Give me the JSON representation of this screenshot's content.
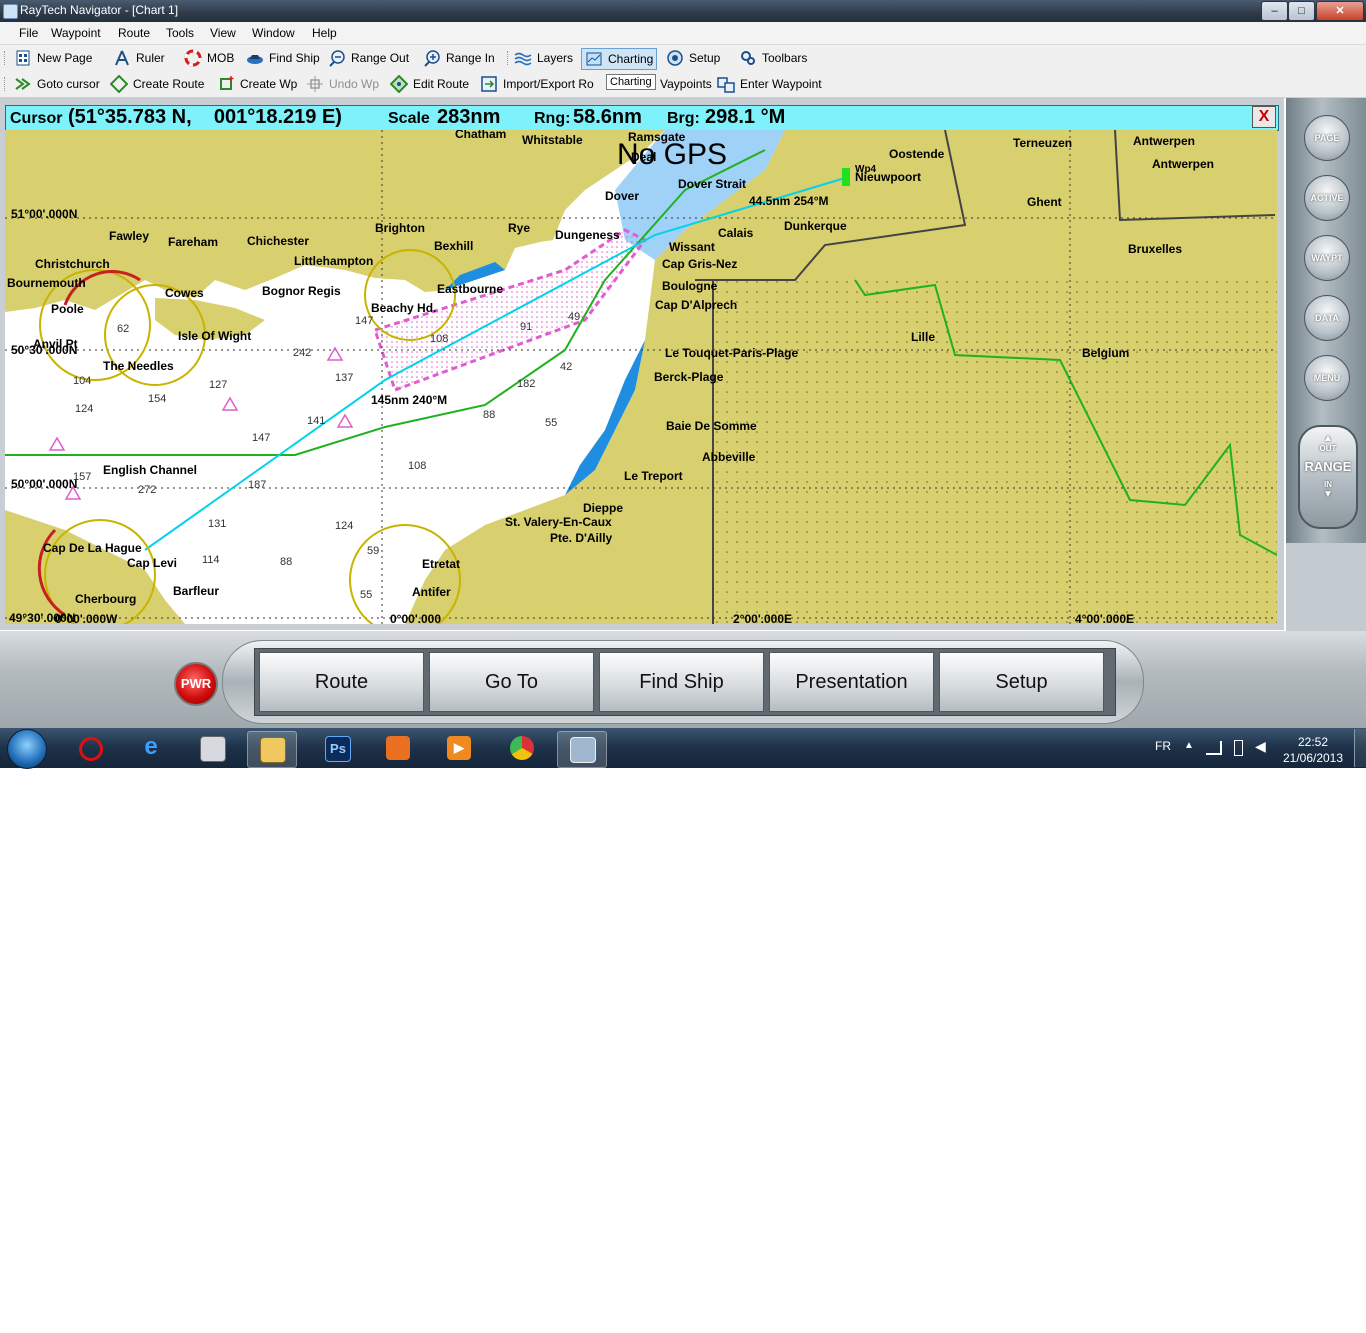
{
  "window": {
    "title": "RayTech Navigator - [Chart 1]",
    "minimize": "–",
    "maximize": "□",
    "close": "✕"
  },
  "menu": [
    "File",
    "Waypoint",
    "Route",
    "Tools",
    "View",
    "Window",
    "Help"
  ],
  "toolbar1": [
    {
      "label": "New Page",
      "icon": "new-page-icon"
    },
    {
      "label": "Ruler",
      "icon": "ruler-icon"
    },
    {
      "label": "MOB",
      "icon": "mob-icon"
    },
    {
      "label": "Find Ship",
      "icon": "find-ship-icon"
    },
    {
      "label": "Range Out",
      "icon": "zoom-out-icon"
    },
    {
      "label": "Range In",
      "icon": "zoom-in-icon"
    },
    {
      "label": "Layers",
      "icon": "layers-icon"
    },
    {
      "label": "Charting",
      "icon": "charting-icon"
    },
    {
      "label": "Setup",
      "icon": "setup-icon"
    },
    {
      "label": "Toolbars",
      "icon": "toolbars-icon"
    }
  ],
  "toolbar2": [
    {
      "label": "Goto cursor",
      "icon": "goto-cursor-icon"
    },
    {
      "label": "Create Route",
      "icon": "create-route-icon"
    },
    {
      "label": "Create Wp",
      "icon": "create-waypoint-icon"
    },
    {
      "label": "Undo Wp",
      "icon": "undo-waypoint-icon"
    },
    {
      "label": "Edit Route",
      "icon": "edit-route-icon"
    },
    {
      "label": "Import/Export Ro",
      "icon": "import-export-icon"
    },
    {
      "label": "Vaypoints",
      "icon": "waypoints-icon"
    },
    {
      "label": "Enter Waypoint",
      "icon": "enter-waypoint-icon"
    }
  ],
  "tooltip": "Charting",
  "cursor_bar": {
    "cursor_label": "Cursor",
    "cursor_value": "(51°35.783 N,    001°18.219 E)",
    "scale_label": "Scale",
    "scale_value": "283nm",
    "rng_label": "Rng:",
    "rng_value": "58.6nm",
    "brg_label": "Brg:",
    "brg_value": "298.1 °M",
    "close": "X"
  },
  "chart": {
    "status": "No GPS",
    "grid_labels": {
      "lat1": "51°00'.000N",
      "lat2": "50°30'.000N",
      "lat3": "50°00'.000N",
      "lat4": "49°30'.000N",
      "lon0": "0°00'.000W",
      "lon1": "0°00'.000",
      "lon2": "2°00'.000E",
      "lon3": "4°00'.000E"
    },
    "route_labels": {
      "leg1": "44.5nm  254°M",
      "leg2": "145nm  240°M",
      "wp": "Wp4"
    },
    "places": [
      "Chatham",
      "Whitstable",
      "Ramsgate",
      "Deal",
      "Oostende",
      "Terneuzen",
      "Antwerpen",
      "Antwerpen",
      "Nieuwpoort",
      "Dover",
      "Dover Strait",
      "Ghent",
      "Fawley",
      "Fareham",
      "Chichester",
      "Brighton",
      "Rye",
      "Dungeness",
      "Calais",
      "Dunkerque",
      "Christchurch",
      "Bexhill",
      "Wissant",
      "Bruxelles",
      "Bournemouth",
      "Littlehampton",
      "Cap Gris-Nez",
      "Cowes",
      "Bognor Regis",
      "Eastbourne",
      "Boulogne",
      "Poole",
      "Beachy Hd.",
      "Cap D'Alprech",
      "Isle Of Wight",
      "Lille",
      "Anvil Pt",
      "Le Touquet-Paris-Plage",
      "Belgium",
      "The Needles",
      "Berck-Plage",
      "Baie De Somme",
      "Abbeville",
      "English Channel",
      "Le Treport",
      "Dieppe",
      "St. Valery-En-Caux",
      "Cap De La Hague",
      "Pte. D'Ailly",
      "Cap Levi",
      "Etretat",
      "Barfleur",
      "Cherbourg",
      "Antifer"
    ],
    "depths": [
      "147",
      "108",
      "91",
      "242",
      "137",
      "104",
      "127",
      "154",
      "124",
      "88",
      "141",
      "55",
      "147",
      "108",
      "157",
      "272",
      "187",
      "131",
      "124",
      "114",
      "88",
      "59",
      "55",
      "182",
      "62",
      "42",
      "49"
    ]
  },
  "side_panel": [
    "PAGE",
    "ACTIVE",
    "WAYPT",
    "DATA",
    "MENU"
  ],
  "range": {
    "out": "OUT",
    "label": "RANGE",
    "in": "IN"
  },
  "bottom_buttons": [
    "Route",
    "Go To",
    "Find Ship",
    "Presentation",
    "Setup"
  ],
  "pwr": "PWR",
  "taskbar": {
    "lang": "FR",
    "time": "22:52",
    "date": "21/06/2013",
    "apps": [
      "blocked-app-icon",
      "internet-explorer-icon",
      "control-panel-icon",
      "file-explorer-icon",
      "photoshop-icon",
      "office-icon",
      "media-player-icon",
      "chrome-icon",
      "raytech-icon"
    ],
    "ps_label": "Ps"
  },
  "colors": {
    "land": "#d8cf6f",
    "sea": "#ffffff",
    "shallow": "#1f8ee0",
    "cursor_bar": "#7ef2fb",
    "route": "#00d3ea",
    "border": "#1fb21f"
  }
}
